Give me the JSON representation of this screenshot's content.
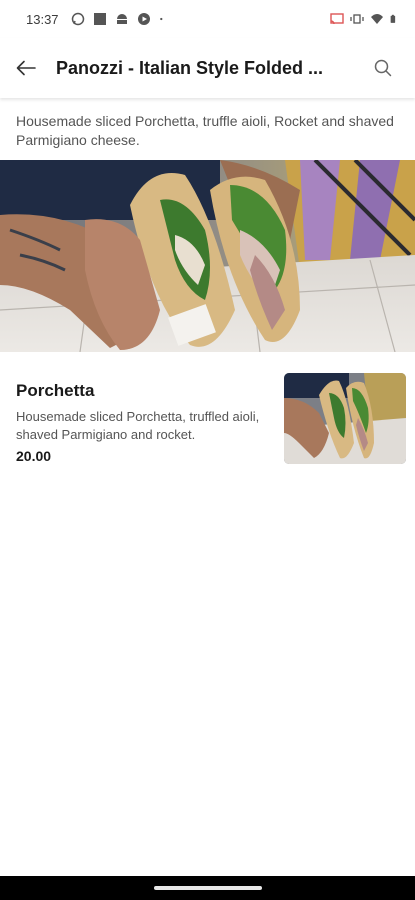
{
  "status_bar": {
    "time": "13:37",
    "left_icons": [
      "whatsapp-icon",
      "square-app-icon",
      "android-icon",
      "play-icon",
      "dot-icon"
    ],
    "right_icons": [
      "cast-icon",
      "vibrate-icon",
      "wifi-icon",
      "battery-icon"
    ]
  },
  "app_bar": {
    "title": "Panozzi - Italian Style Folded ...",
    "back_icon": "arrow-left-icon",
    "search_icon": "search-icon"
  },
  "category": {
    "description": "Housemade sliced Porchetta, truffle aioli, Rocket and shaved Parmigiano  cheese."
  },
  "items": [
    {
      "name": "Porchetta",
      "description": "Housemade sliced Porchetta, truffled aioli, shaved Parmigiano and rocket.",
      "price": "20.00"
    }
  ],
  "colors": {
    "text_primary": "#1a1a1a",
    "text_secondary": "#555555",
    "nav_bar": "#000000"
  }
}
